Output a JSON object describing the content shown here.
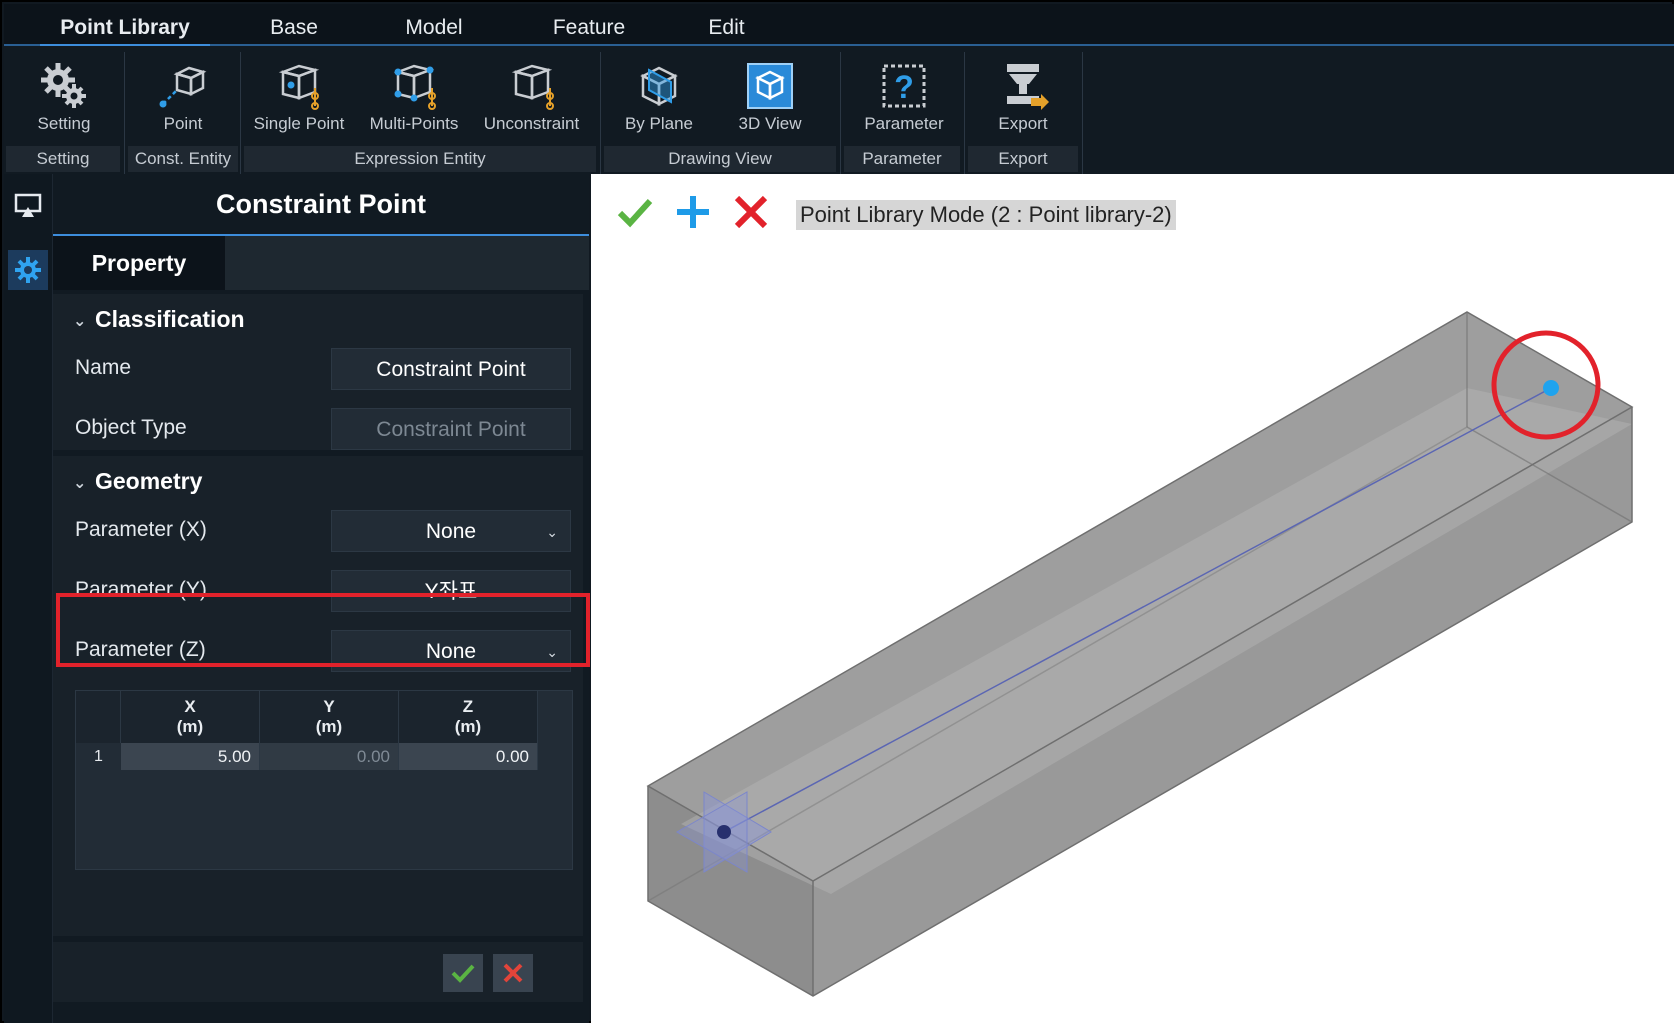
{
  "menubar": {
    "items": [
      "Point Library",
      "Base",
      "Model",
      "Feature",
      "Edit"
    ],
    "active": "Point Library"
  },
  "ribbon": {
    "buttons": [
      {
        "label": "Setting",
        "icon": "gear-icon"
      },
      {
        "label": "Point",
        "icon": "point-cube-icon"
      },
      {
        "label": "Single Point",
        "icon": "single-point-icon"
      },
      {
        "label": "Multi-Points",
        "icon": "multi-points-icon"
      },
      {
        "label": "Unconstraint",
        "icon": "unconstraint-icon"
      },
      {
        "label": "By Plane",
        "icon": "by-plane-icon"
      },
      {
        "label": "3D View",
        "icon": "3d-view-icon"
      },
      {
        "label": "Parameter",
        "icon": "parameter-icon"
      },
      {
        "label": "Export",
        "icon": "export-icon"
      }
    ],
    "groups": [
      "Setting",
      "Const. Entity",
      "Expression Entity",
      "Drawing View",
      "Parameter",
      "Export"
    ]
  },
  "panel": {
    "title": "Constraint Point",
    "tab": "Property",
    "classification": {
      "header": "Classification",
      "name_label": "Name",
      "name_value": "Constraint Point",
      "type_label": "Object Type",
      "type_value": "Constraint Point"
    },
    "geometry": {
      "header": "Geometry",
      "px_label": "Parameter (X)",
      "px_value": "None",
      "py_label": "Parameter (Y)",
      "py_value": "Y좌표",
      "pz_label": "Parameter (Z)",
      "pz_value": "None",
      "table": {
        "headers": [
          {
            "axis": "X",
            "unit": "(m)"
          },
          {
            "axis": "Y",
            "unit": "(m)"
          },
          {
            "axis": "Z",
            "unit": "(m)"
          }
        ],
        "rows": [
          {
            "index": "1",
            "x": "5.00",
            "y": "0.00",
            "z": "0.00"
          }
        ]
      }
    }
  },
  "viewport": {
    "mode_text": "Point Library Mode (2 : Point library-2)"
  },
  "colors": {
    "accent": "#3d8ddc",
    "highlight_red": "#e2222b",
    "confirm_green": "#5ab443",
    "point_blue": "#1fa3ee"
  }
}
